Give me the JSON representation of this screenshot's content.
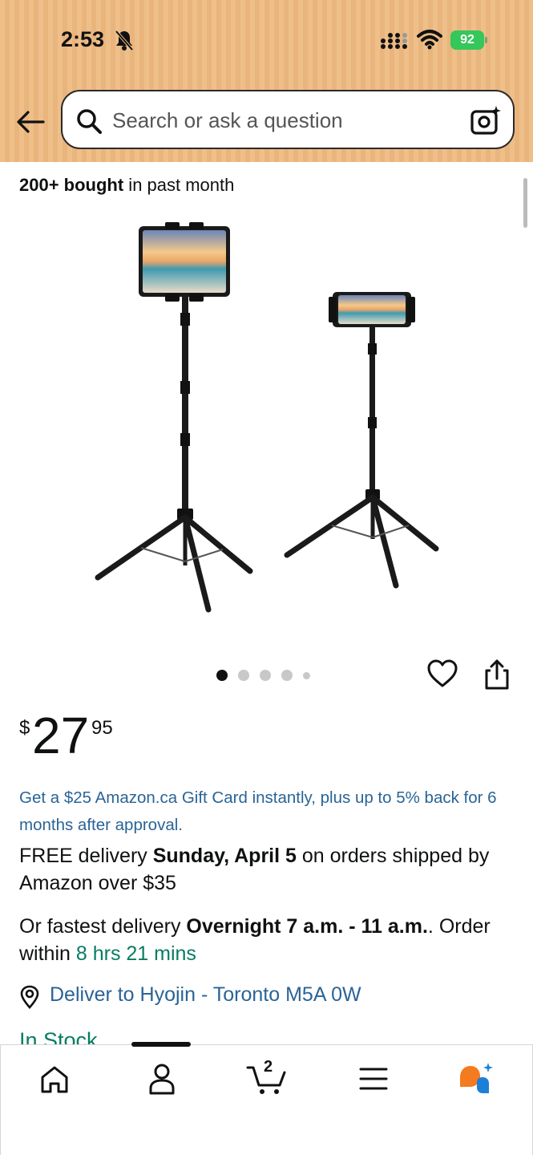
{
  "status_bar": {
    "time": "2:53",
    "battery": "92"
  },
  "header": {
    "search_placeholder": "Search or ask a question"
  },
  "product": {
    "bought_count": "200+ bought",
    "bought_suffix": " in past month",
    "image_count": 5,
    "active_image": 1,
    "price_symbol": "$",
    "price_whole": "27",
    "price_fraction": "95",
    "promo": "Get a $25 Amazon.ca Gift Card instantly, plus up to 5% back for 6 months after approval.",
    "delivery_prefix": "FREE delivery ",
    "delivery_date": "Sunday, April 5",
    "delivery_suffix": " on orders shipped by Amazon over $35",
    "fastest_prefix": "Or fastest delivery ",
    "fastest_window": "Overnight 7 a.m. - 11 a.m.",
    "fastest_mid": ". Order within ",
    "fastest_countdown": "8 hrs 21 mins",
    "deliver_to": "Deliver to Hyojin - Toronto M5A 0W",
    "stock_status": "In Stock"
  },
  "bottom_nav": {
    "cart_count": "2",
    "active_tab": "account"
  },
  "colors": {
    "link": "#2a6496",
    "green": "#067d62",
    "header_bg": "#efbf8a",
    "battery": "#34c759"
  }
}
